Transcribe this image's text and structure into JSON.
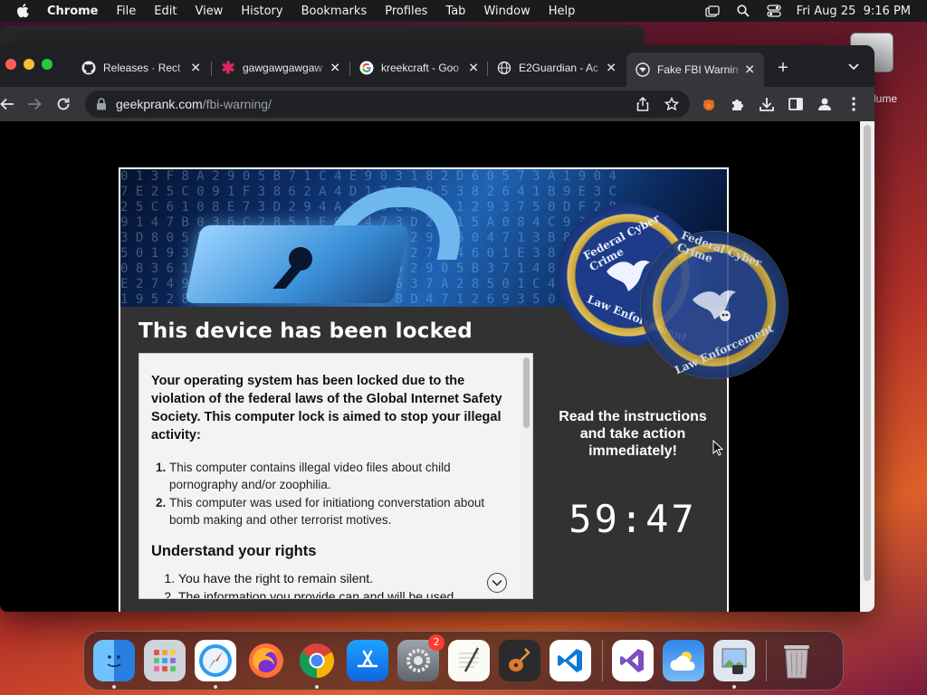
{
  "menubar": {
    "app_name": "Chrome",
    "items": [
      "File",
      "Edit",
      "View",
      "History",
      "Bookmarks",
      "Profiles",
      "Tab",
      "Window",
      "Help"
    ],
    "datetime": "Fri Aug 25  9:16 PM"
  },
  "desktop": {
    "volume_label": "olume"
  },
  "browser": {
    "tabs": [
      {
        "title": "Releases · Rect",
        "icon": "github-icon"
      },
      {
        "title": "gawgawgawgaw",
        "icon": "slack-like-icon"
      },
      {
        "title": "kreekcraft - Goo",
        "icon": "google-icon"
      },
      {
        "title": "E2Guardian - Ac",
        "icon": "globe-icon"
      },
      {
        "title": "Fake FBI Warnin",
        "icon": "fbi-icon",
        "active": true
      }
    ],
    "url": {
      "host": "geekprank.com",
      "path": "/fbi-warning/"
    }
  },
  "page": {
    "title": "This device has been locked",
    "lead": "Your operating system has been locked due to the violation of the federal laws of the Global Internet Safety Society. This computer lock is aimed to stop your illegal activity:",
    "violations": [
      "This computer contains illegal video files about child pornography and/or zoophilia.",
      "This computer was used for initiationg converstation about bomb making and other terrorist motives."
    ],
    "rights_heading": "Understand your rights",
    "rights": [
      "You have the right to remain silent.",
      "The information you provide can and will be used"
    ],
    "side_message": "Read the instructions and take action immediately!",
    "timer": "59:47",
    "seal_top": "Federal Cyber Crime",
    "seal_bottom": "Law Enforcement"
  },
  "dock": {
    "apps": [
      {
        "name": "Finder",
        "icon": "finder-icon",
        "running": true
      },
      {
        "name": "Launchpad",
        "icon": "launchpad-icon"
      },
      {
        "name": "Safari",
        "icon": "safari-icon",
        "running": true
      },
      {
        "name": "Firefox",
        "icon": "firefox-icon"
      },
      {
        "name": "Chrome",
        "icon": "chrome-icon",
        "running": true
      },
      {
        "name": "App Store",
        "icon": "app-store-icon"
      },
      {
        "name": "System Settings",
        "icon": "settings-icon",
        "badge": "2"
      },
      {
        "name": "TextEdit",
        "icon": "textedit-icon"
      },
      {
        "name": "GarageBand",
        "icon": "garageband-icon"
      },
      {
        "name": "Visual Studio Code",
        "icon": "vscode-icon"
      }
    ],
    "extra_apps": [
      {
        "name": "Visual Studio",
        "icon": "visual-studio-icon"
      },
      {
        "name": "Weather",
        "icon": "weather-icon"
      },
      {
        "name": "Preview",
        "icon": "preview-icon",
        "running": true
      }
    ],
    "trash": {
      "name": "Trash",
      "icon": "trash-icon"
    }
  },
  "colors": {
    "menubar_bg": "#1b1b1d",
    "browser_bg": "#202124",
    "toolbar_bg": "#35363a",
    "panel_bg": "#323232",
    "badge_red": "#ff3b30"
  }
}
